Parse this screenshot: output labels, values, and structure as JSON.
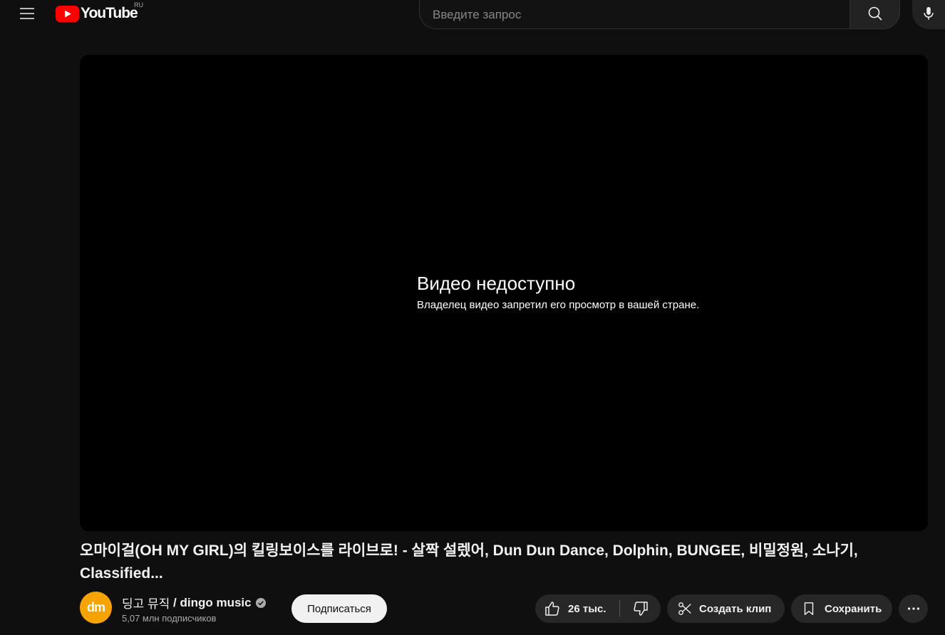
{
  "header": {
    "logo_text": "YouTube",
    "country_code": "RU",
    "search_placeholder": "Введите запрос"
  },
  "player": {
    "error_title": "Видео недоступно",
    "error_message": "Владелец видео запретил его просмотр в вашей стране."
  },
  "video": {
    "title": "오마이걸(OH MY GIRL)의 킬링보이스를 라이브로! - 살짝 설렜어, Dun Dun Dance, Dolphin, BUNGEE, 비밀정원, 소나기, Classified..."
  },
  "channel": {
    "avatar_text": "dm",
    "name_korean": "딩고 뮤직",
    "name_separator": " / ",
    "name_latin": "dingo music",
    "subscribers": "5,07 млн подписчиков",
    "subscribe_label": "Подписаться"
  },
  "actions": {
    "likes": "26 тыс.",
    "clip_label": "Создать клип",
    "save_label": "Сохранить"
  },
  "colors": {
    "background": "#0f0f0f",
    "brand_red": "#ff0000",
    "avatar_bg": "#f5a300",
    "pill_bg": "#272727"
  }
}
